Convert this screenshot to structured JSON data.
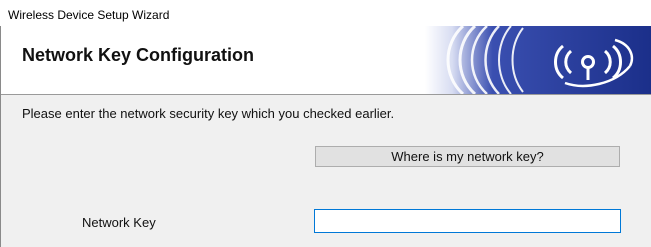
{
  "window": {
    "title": "Wireless Device Setup Wizard"
  },
  "header": {
    "title": "Network Key Configuration",
    "banner_icon": "wireless-signal-logo",
    "accent_color": "#1f3f9f"
  },
  "content": {
    "instruction": "Please enter the network security key which you checked earlier.",
    "help_button_label": "Where is my network key?",
    "network_key_label": "Network Key",
    "network_key_value": "",
    "focus_color": "#0078d7"
  }
}
